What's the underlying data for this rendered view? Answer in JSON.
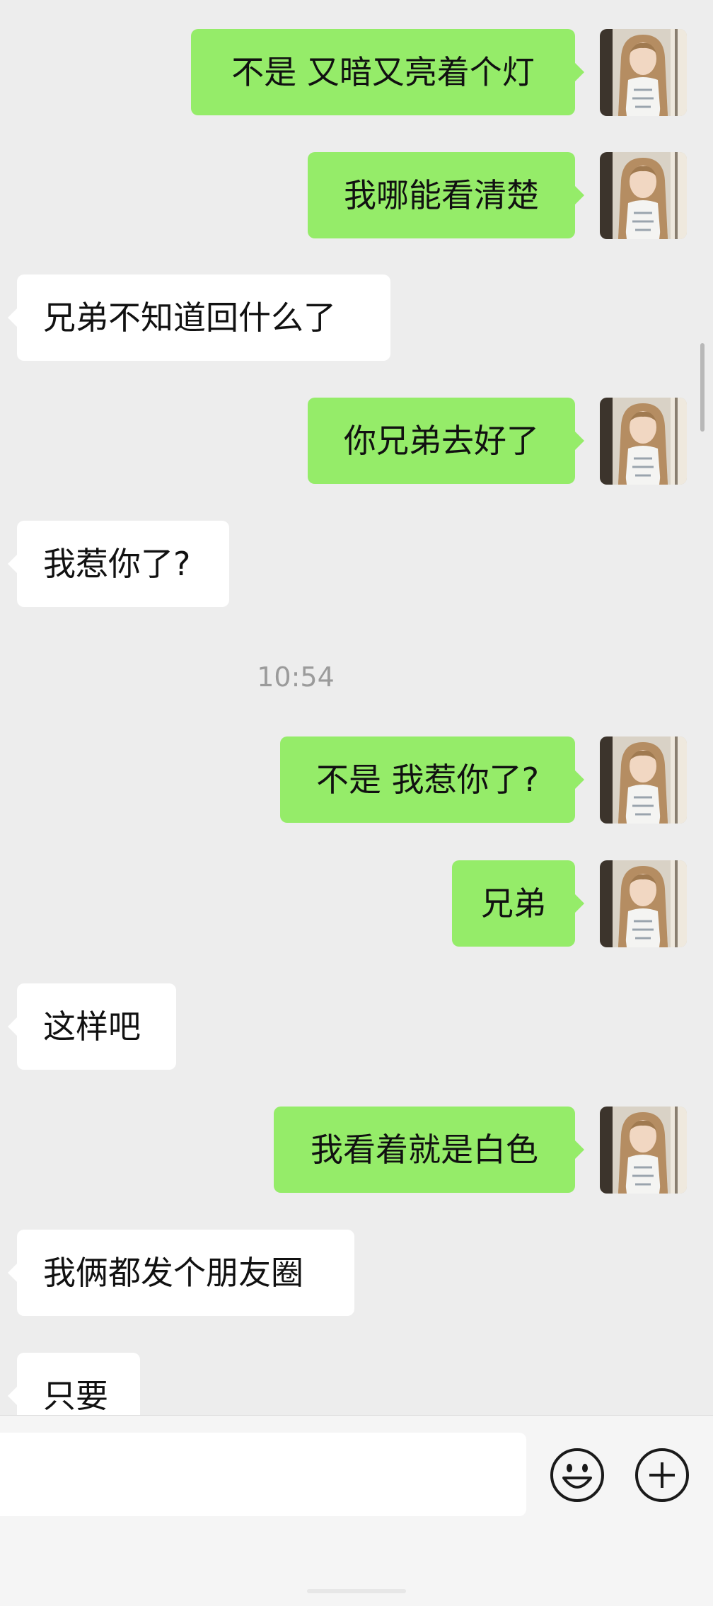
{
  "chat": {
    "messages": [
      {
        "direction": "outgoing",
        "text": "不是 又暗又亮着个灯"
      },
      {
        "direction": "outgoing",
        "text": "我哪能看清楚"
      },
      {
        "direction": "incoming",
        "text": "兄弟不知道回什么了"
      },
      {
        "direction": "outgoing",
        "text": "你兄弟去好了"
      },
      {
        "direction": "incoming",
        "text": "我惹你了?"
      },
      {
        "direction": "outgoing",
        "text": "不是 我惹你了?"
      },
      {
        "direction": "outgoing",
        "text": "兄弟"
      },
      {
        "direction": "incoming",
        "text": "这样吧"
      },
      {
        "direction": "outgoing",
        "text": "我看着就是白色"
      },
      {
        "direction": "incoming",
        "text": "我俩都发个朋友圈"
      },
      {
        "direction": "incoming",
        "text": "只要"
      }
    ],
    "timestamp": "10:54"
  },
  "input_bar": {
    "text_value": "",
    "emoji_icon": "smiley-face-icon",
    "plus_icon": "plus-circle-icon"
  },
  "colors": {
    "background": "#ededed",
    "outgoing_bubble": "#95ec69",
    "incoming_bubble": "#ffffff",
    "timestamp_text": "#9b9b9b"
  }
}
